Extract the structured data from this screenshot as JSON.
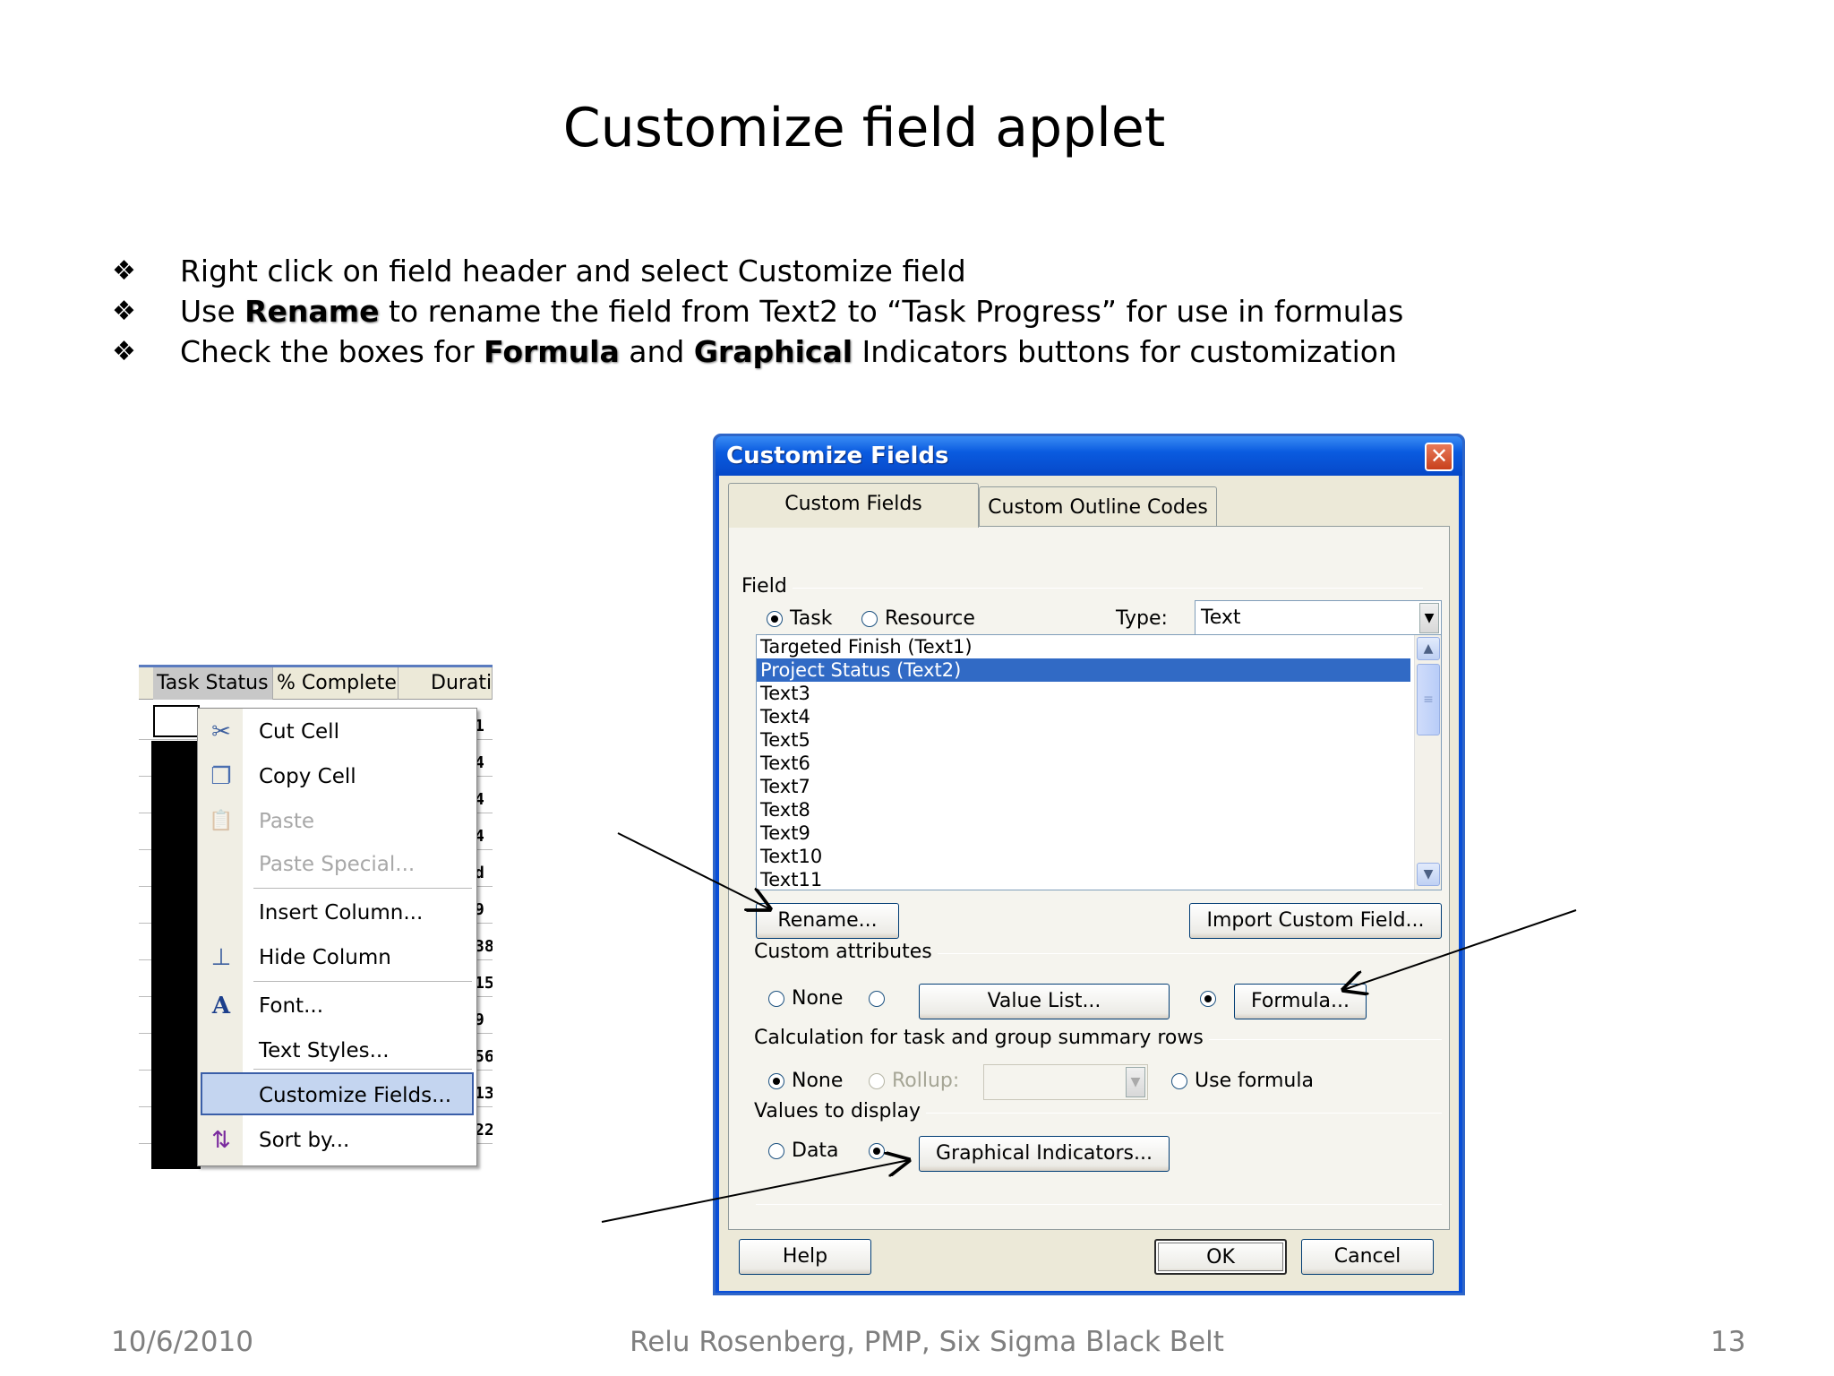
{
  "slide": {
    "title": "Customize field applet",
    "bullets": [
      {
        "parts": [
          {
            "text": "Right click on field header and select Customize field",
            "bold": false
          }
        ]
      },
      {
        "parts": [
          {
            "text": "Use ",
            "bold": false
          },
          {
            "text": "Rename",
            "bold": true
          },
          {
            "text": " to rename the field from Text2 to “Task Progress” for use in formulas",
            "bold": false
          }
        ]
      },
      {
        "parts": [
          {
            "text": "Check the boxes for  ",
            "bold": false
          },
          {
            "text": "Formula",
            "bold": true
          },
          {
            "text": " and ",
            "bold": false
          },
          {
            "text": "Graphical",
            "bold": true
          },
          {
            "text": " Indicators buttons for customization",
            "bold": false
          }
        ]
      }
    ],
    "bullet_glyph": "❖",
    "footer": {
      "date": "10/6/2010",
      "author": "Relu Rosenberg, PMP, Six Sigma Black Belt",
      "page": "13"
    }
  },
  "grid": {
    "headers": [
      "Task Status",
      "% Complete",
      "Durati"
    ],
    "right_col": [
      "1",
      "4",
      "4",
      "4",
      "d",
      "9",
      "38",
      "15",
      "9",
      "56",
      "13",
      "22"
    ]
  },
  "context_menu": {
    "items": [
      {
        "label": "Cut Cell",
        "icon": "scissors-icon",
        "glyph": "✂",
        "disabled": false
      },
      {
        "label": "Copy Cell",
        "icon": "copy-icon",
        "glyph": "❐",
        "disabled": false
      },
      {
        "label": "Paste",
        "icon": "paste-icon",
        "glyph": "📋",
        "disabled": true
      },
      {
        "label": "Paste Special...",
        "icon": "",
        "glyph": "",
        "disabled": true
      },
      {
        "label": "Insert Column...",
        "icon": "",
        "glyph": "",
        "disabled": false
      },
      {
        "label": "Hide Column",
        "icon": "hide-column-icon",
        "glyph": "⊥",
        "disabled": false
      },
      {
        "label": "Font...",
        "icon": "font-icon",
        "glyph": "A",
        "disabled": false
      },
      {
        "label": "Text Styles...",
        "icon": "",
        "glyph": "",
        "disabled": false
      },
      {
        "label": "Customize Fields...",
        "icon": "",
        "glyph": "",
        "disabled": false,
        "selected": true
      },
      {
        "label": "Sort by...",
        "icon": "sort-az-icon",
        "glyph": "⇅",
        "disabled": false
      }
    ]
  },
  "dialog": {
    "title": "Customize Fields",
    "close_glyph": "✕",
    "tabs": [
      {
        "label": "Custom Fields",
        "active": true
      },
      {
        "label": "Custom Outline Codes",
        "active": false
      }
    ],
    "field_group": "Field",
    "radio_task": "Task",
    "radio_resource": "Resource",
    "type_label": "Type:",
    "type_value": "Text",
    "list_items": [
      "Targeted Finish (Text1)",
      "Project Status (Text2)",
      "Text3",
      "Text4",
      "Text5",
      "Text6",
      "Text7",
      "Text8",
      "Text9",
      "Text10",
      "Text11"
    ],
    "selected_index": 1,
    "rename_button": "Rename...",
    "import_button": "Import Custom Field...",
    "custom_attributes_group": "Custom attributes",
    "attr_none": "None",
    "value_list_button": "Value List...",
    "formula_button": "Formula...",
    "calculation_group": "Calculation for task and group summary rows",
    "calc_none": "None",
    "calc_rollup": "Rollup:",
    "calc_use_formula": "Use formula",
    "values_group": "Values to display",
    "values_data": "Data",
    "graphical_button": "Graphical Indicators...",
    "help_button": "Help",
    "ok_button": "OK",
    "cancel_button": "Cancel"
  },
  "colors": {
    "title_bar": "#0a5be0",
    "selection": "#316ac5",
    "dialog_face": "#ece9d8",
    "menu_highlight": "#c4d5f0"
  }
}
